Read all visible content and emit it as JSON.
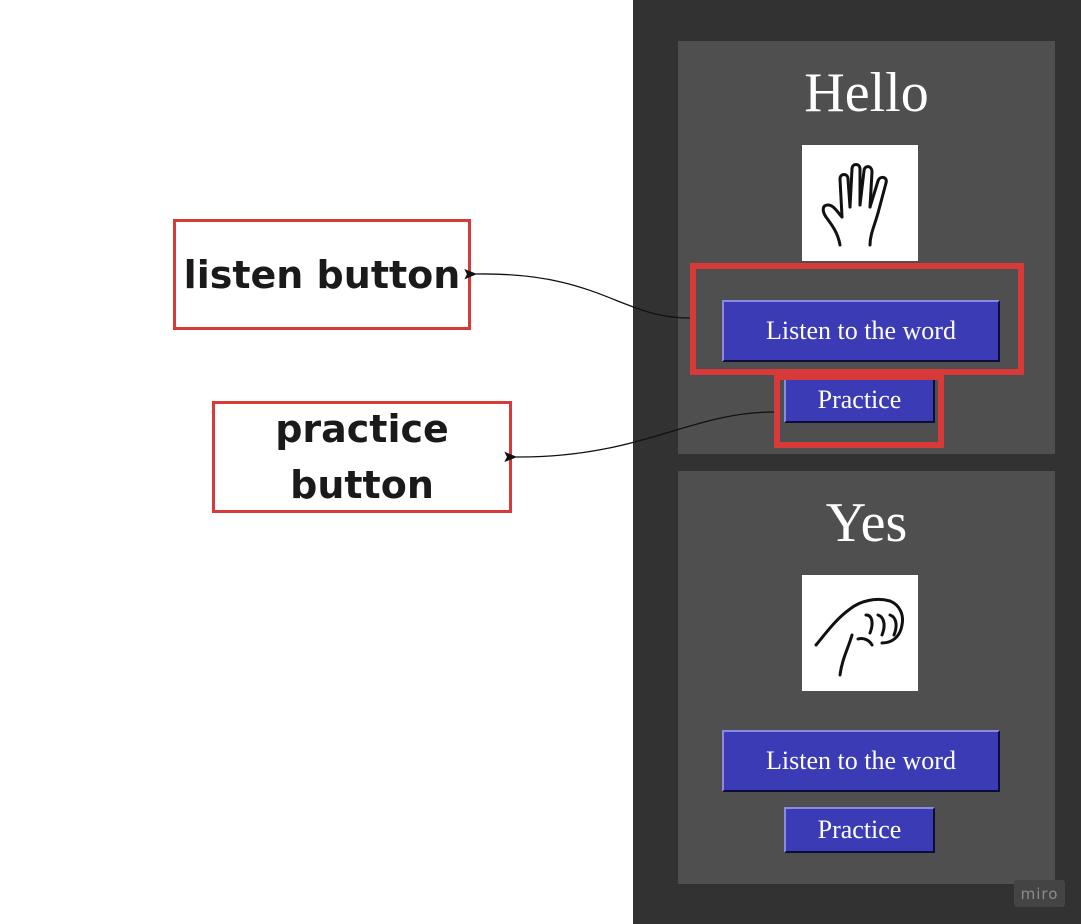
{
  "annotations": {
    "listen_label": "listen button",
    "practice_label": "practice button"
  },
  "cards": [
    {
      "word": "Hello",
      "image_icon": "open-hand-sign-icon",
      "listen_label": "Listen to the word",
      "practice_label": "Practice"
    },
    {
      "word": "Yes",
      "image_icon": "fist-sign-icon",
      "listen_label": "Listen to the word",
      "practice_label": "Practice"
    }
  ],
  "watermark": "miro",
  "colors": {
    "panel_bg": "#323232",
    "card_bg": "#4f4f4f",
    "button_bg": "#3b3bb5",
    "highlight": "#d83a3a",
    "text_light": "#ffffff"
  }
}
